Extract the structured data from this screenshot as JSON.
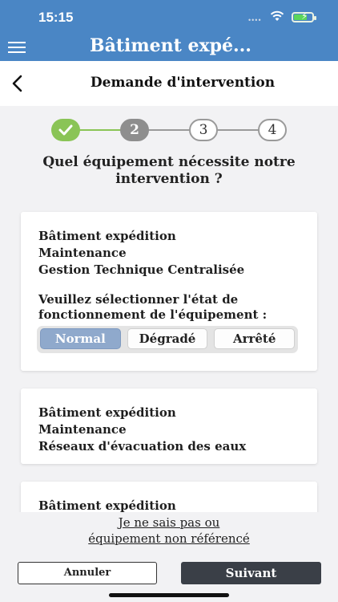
{
  "status_bar": {
    "time": "15:15",
    "dots": "••••"
  },
  "header": {
    "title": "Bâtiment expé..."
  },
  "nav": {
    "title": "Demande d'intervention"
  },
  "stepper": {
    "steps": [
      {
        "label": "",
        "state": "done"
      },
      {
        "label": "2",
        "state": "current"
      },
      {
        "label": "3",
        "state": "todo"
      },
      {
        "label": "4",
        "state": "todo"
      }
    ],
    "colors": {
      "done": "#8ac456",
      "current": "#8e8e8e",
      "todo": "#9a9a9a"
    }
  },
  "question": "Quel équipement nécessite notre intervention ?",
  "cards": [
    {
      "lines": [
        "Bâtiment expédition",
        "Maintenance",
        "Gestion Technique Centralisée"
      ],
      "prompt": "Veuillez sélectionner l'état de fonctionnement de l'équipement :",
      "options": [
        "Normal",
        "Dégradé",
        "Arrêté"
      ],
      "selected": "Normal"
    },
    {
      "lines": [
        "Bâtiment expédition",
        "Maintenance",
        "Réseaux d'évacuation des eaux"
      ]
    },
    {
      "lines": [
        "Bâtiment expédition"
      ]
    }
  ],
  "unknown_link": {
    "line1": "Je ne sais pas ou",
    "line2": "équipement non référencé"
  },
  "actions": {
    "cancel": "Annuler",
    "next": "Suivant"
  },
  "colors": {
    "header": "#4a86c5",
    "accent_selected": "#8fa9cc",
    "primary_button": "#3a3f47"
  }
}
